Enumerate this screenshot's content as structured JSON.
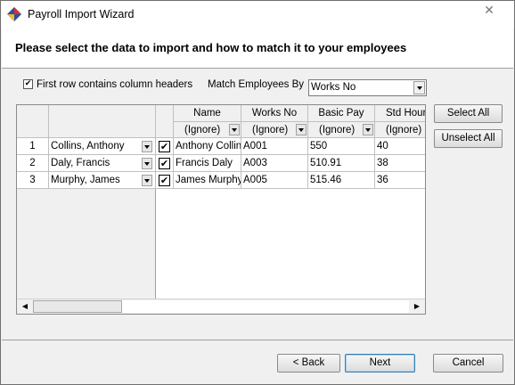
{
  "window": {
    "title": "Payroll Import Wizard",
    "close_glyph": "✕"
  },
  "header": {
    "text": "Please select the data to import and how to match it to your employees"
  },
  "options": {
    "first_row_label": "First row contains column headers",
    "first_row_checked": true,
    "match_label": "Match Employees By",
    "match_value": "Works No"
  },
  "side_buttons": {
    "select_all": "Select All",
    "unselect_all": "Unselect All"
  },
  "grid": {
    "columns": [
      {
        "name": "Name",
        "mapping": "(Ignore)"
      },
      {
        "name": "Works No",
        "mapping": "(Ignore)"
      },
      {
        "name": "Basic Pay",
        "mapping": "(Ignore)"
      },
      {
        "name": "Std Hours",
        "mapping": "(Ignore)"
      }
    ],
    "rows": [
      {
        "num": "1",
        "employee": "Collins, Anthony",
        "checked": true,
        "values": [
          "Anthony Collins",
          "A001",
          "550",
          "40"
        ]
      },
      {
        "num": "2",
        "employee": "Daly, Francis",
        "checked": true,
        "values": [
          "Francis Daly",
          "A003",
          "510.91",
          "38"
        ]
      },
      {
        "num": "3",
        "employee": "Murphy, James",
        "checked": true,
        "values": [
          "James Murphy",
          "A005",
          "515.46",
          "36"
        ]
      }
    ]
  },
  "footer": {
    "back": "< Back",
    "next": "Next",
    "cancel": "Cancel"
  },
  "icons": {
    "app": "payroll-app-icon",
    "close": "close-icon",
    "check": "✔"
  },
  "colors": {
    "default_button_border": "#3c7fb1"
  }
}
